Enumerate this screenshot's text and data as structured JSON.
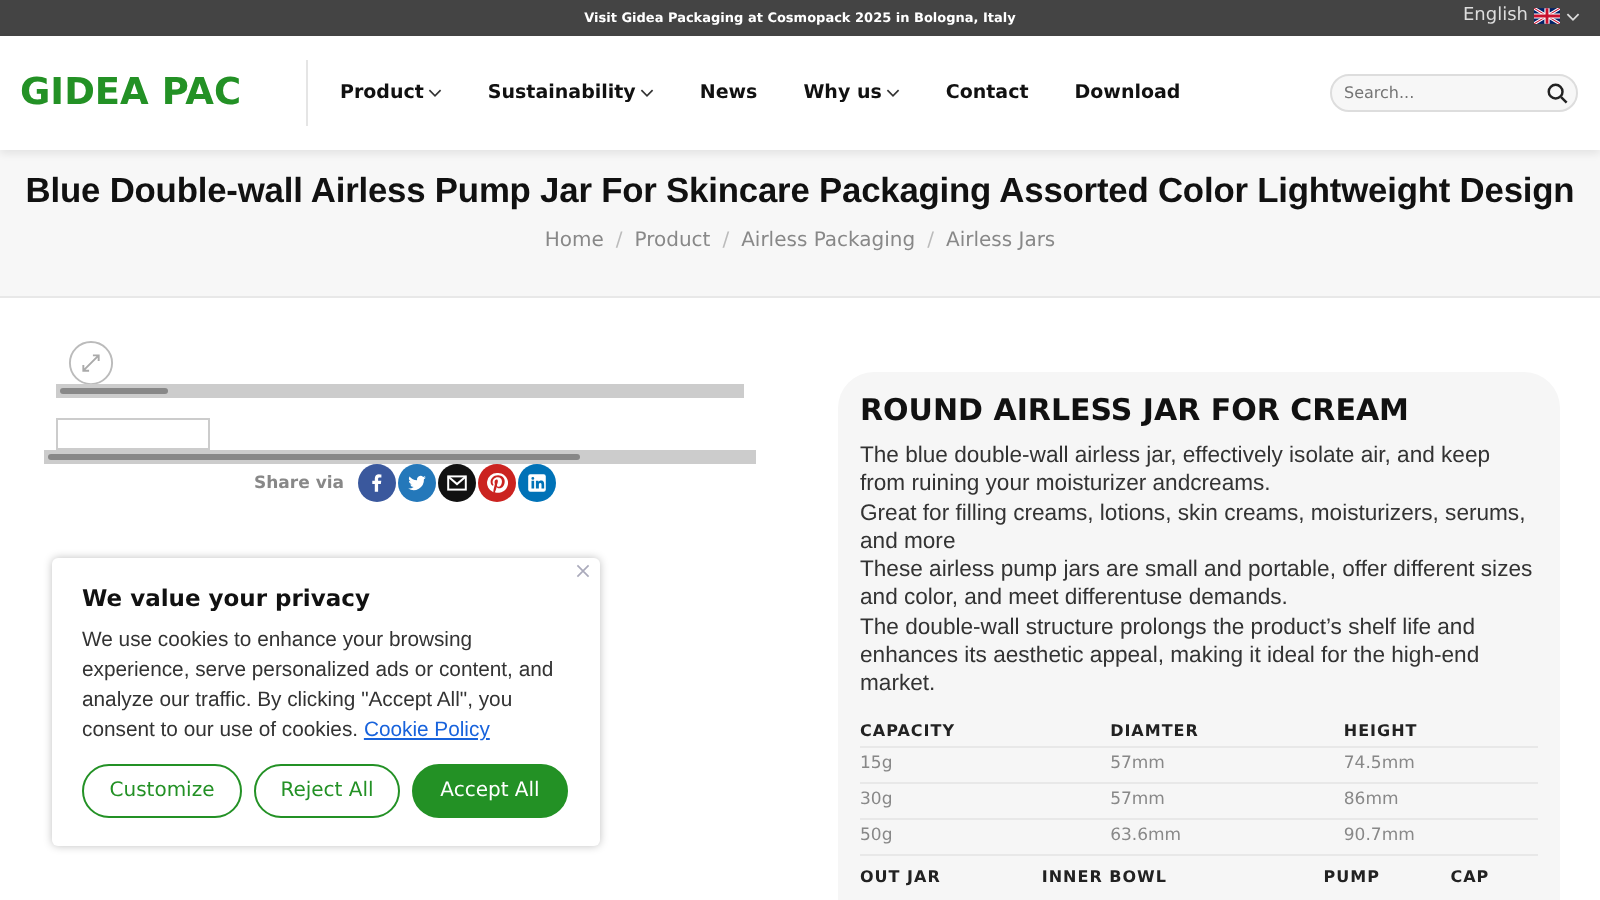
{
  "topbar": {
    "announcement": "Visit Gidea Packaging at Cosmopack 2025 in Bologna, Italy",
    "language": "English"
  },
  "header": {
    "logo": "GIDEA PAC",
    "nav": [
      {
        "label": "Product",
        "dropdown": true
      },
      {
        "label": "Sustainability",
        "dropdown": true
      },
      {
        "label": "News",
        "dropdown": false
      },
      {
        "label": "Why us",
        "dropdown": true
      },
      {
        "label": "Contact",
        "dropdown": false
      },
      {
        "label": "Download",
        "dropdown": false
      }
    ],
    "search": {
      "placeholder": "Search..."
    }
  },
  "page_title": "Blue Double-wall Airless Pump Jar For Skincare Packaging Assorted Color Lightweight Design",
  "breadcrumb": [
    "Home",
    "Product",
    "Airless Packaging",
    "Airless Jars"
  ],
  "breadcrumb_separator": "/",
  "share": {
    "label": "Share via",
    "networks": [
      {
        "kind": "facebook",
        "color": "#3a589d"
      },
      {
        "kind": "twitter",
        "color": "#2478ba"
      },
      {
        "kind": "email",
        "color": "#111111"
      },
      {
        "kind": "pinterest",
        "color": "#cb2320"
      },
      {
        "kind": "linkedin",
        "color": "#0072b7"
      }
    ]
  },
  "product": {
    "heading": "ROUND AIRLESS JAR FOR CREAM",
    "description": [
      "The blue double-wall airless jar, effectively isolate air, and keep from ruining your moisturizer andcreams.",
      "Great for filling creams, lotions, skin creams, moisturizers, serums, and more",
      "These airless pump jars are small and portable, offer different sizes and color, and meet differentuse demands.",
      "The double-wall structure prolongs the product’s shelf life and enhances its aesthetic appeal, making it ideal for the high-end market."
    ],
    "size_table": {
      "columns": [
        "CAPACITY",
        "DIAMTER",
        "HEIGHT"
      ],
      "rows": [
        [
          "15g",
          "57mm",
          "74.5mm"
        ],
        [
          "30g",
          "57mm",
          "86mm"
        ],
        [
          "50g",
          "63.6mm",
          "90.7mm"
        ]
      ]
    },
    "material_table": {
      "columns": [
        "OUT JAR",
        "INNER BOWL",
        "PUMP",
        "CAP"
      ]
    }
  },
  "cookie": {
    "title": "We value your privacy",
    "text": "We use cookies to enhance your browsing experience, serve personalized ads or content, and analyze our traffic. By clicking \"Accept All\", you consent to our use of cookies.",
    "link": "Cookie Policy",
    "buttons": [
      {
        "label": "Customize",
        "kind": "outline"
      },
      {
        "label": "Reject All",
        "kind": "outline"
      },
      {
        "label": "Accept All",
        "kind": "filled"
      }
    ]
  }
}
